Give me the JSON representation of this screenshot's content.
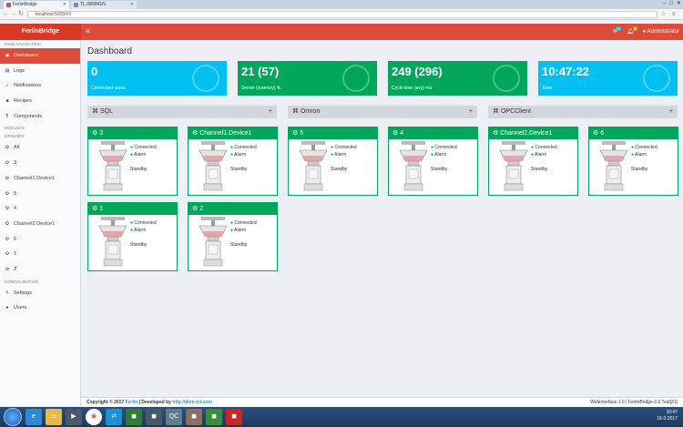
{
  "browser": {
    "tabs": [
      {
        "label": "FerlinBridge",
        "active": true
      },
      {
        "label": "TL-WR841N",
        "active": false
      }
    ],
    "url": "localhost:5000/#!/",
    "controls": {
      "minimize": "–",
      "maximize": "□",
      "close": "✕"
    }
  },
  "header": {
    "logo": "FerlinBridge",
    "menu_icon": "hamburger-icon",
    "mail_badge": "13",
    "bell_badge": "3",
    "user": "Administrator"
  },
  "sidebar": {
    "sections": [
      {
        "title": "MAIN NAVIGATION",
        "items": [
          {
            "label": "Dashboard",
            "icon": "dashboard-icon",
            "active": true
          },
          {
            "label": "Logs",
            "icon": "book-icon"
          },
          {
            "label": "Notifications",
            "icon": "bell-icon"
          },
          {
            "label": "Recipes",
            "icon": "recipes-icon"
          },
          {
            "label": "Components",
            "icon": "paragraph-icon"
          }
        ]
      },
      {
        "title": "MODULES",
        "items": []
      },
      {
        "title": "GRAVIMIX",
        "items": [
          {
            "label": "All",
            "icon": "gears-icon"
          },
          {
            "label": "3",
            "icon": "gear-icon"
          },
          {
            "label": "Channel1.Device1",
            "icon": "gear-icon"
          },
          {
            "label": "5",
            "icon": "gear-icon"
          },
          {
            "label": "4",
            "icon": "gear-icon"
          },
          {
            "label": "Channel2.Device1",
            "icon": "gear-icon"
          },
          {
            "label": "6",
            "icon": "gear-icon"
          },
          {
            "label": "1",
            "icon": "gear-icon"
          },
          {
            "label": "2",
            "icon": "gear-icon"
          }
        ]
      },
      {
        "title": "CONFIGURATION",
        "items": [
          {
            "label": "Settings",
            "icon": "wrench-icon"
          },
          {
            "label": "Users",
            "icon": "users-icon"
          }
        ]
      }
    ]
  },
  "main": {
    "title": "Dashboard",
    "info_boxes": [
      {
        "value": "0",
        "label": "Connected users",
        "color": "#00c0ef",
        "icon": "user-plus-icon"
      },
      {
        "value": "21 (57)",
        "label": "Server (memory) %",
        "color": "#00a65a",
        "icon": "lungs-icon"
      },
      {
        "value": "249 (296)",
        "label": "Cycle time (avg) ms",
        "color": "#00a65a",
        "icon": "stopwatch-icon"
      },
      {
        "value": "10:47:22",
        "label": "Time",
        "color": "#00c0ef",
        "icon": "clock-icon"
      }
    ],
    "groups": [
      {
        "label": "SQL",
        "plus": "+"
      },
      {
        "label": "Omron",
        "plus": "+"
      },
      {
        "label": "OPCClient",
        "plus": "+"
      }
    ],
    "devices": [
      {
        "name": "3",
        "connected": "Connected",
        "alarm": "Alarm",
        "state": "Standby"
      },
      {
        "name": "Channel1.Device1",
        "connected": "Connected",
        "alarm": "Alarm",
        "state": "Standby"
      },
      {
        "name": "5",
        "connected": "Connected",
        "alarm": "Alarm",
        "state": "Standby"
      },
      {
        "name": "4",
        "connected": "Connected",
        "alarm": "Alarm",
        "state": "Standby"
      },
      {
        "name": "Channel2.Device1",
        "connected": "Connected",
        "alarm": "Alarm",
        "state": "Standby"
      },
      {
        "name": "6",
        "connected": "Connected",
        "alarm": "Alarm",
        "state": "Standby"
      },
      {
        "name": "1",
        "connected": "Connected",
        "alarm": "Alarm",
        "state": "Standby"
      },
      {
        "name": "2",
        "connected": "Connected",
        "alarm": "Alarm",
        "state": "Standby"
      }
    ]
  },
  "footer": {
    "left_prefix": "Copyright © 2017 ",
    "left_brand": "Ferlin",
    "left_mid": " | Developed by ",
    "left_link": "http://dnm-ict.com",
    "right": "Webinterface 1.0 | FerlinBridge 2.0 Test[31]"
  },
  "taskbar": {
    "time": "10:47",
    "date": "16-3-2017"
  }
}
